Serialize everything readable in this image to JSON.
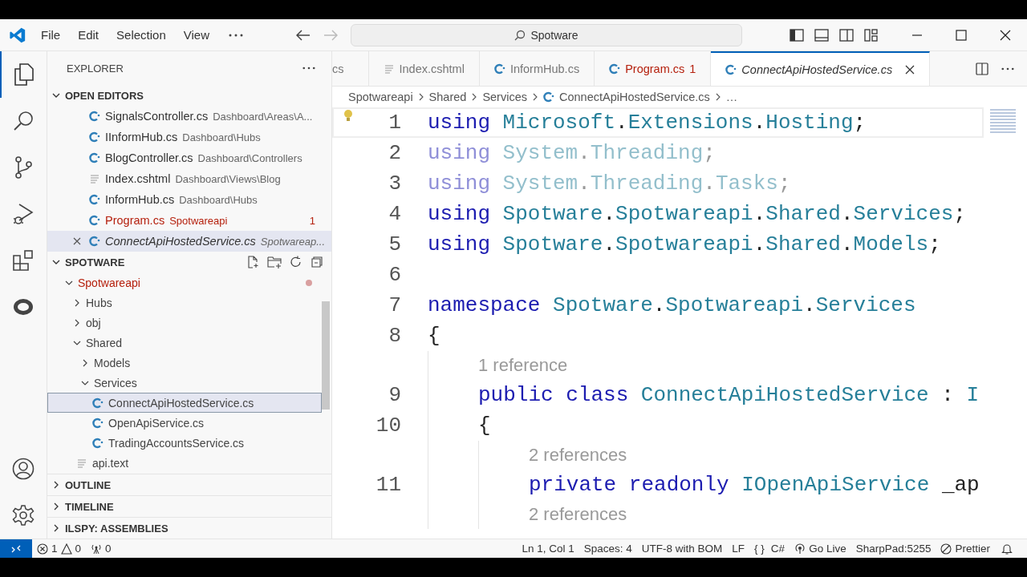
{
  "title_bar": {
    "menus": [
      "File",
      "Edit",
      "Selection",
      "View"
    ],
    "search": "Spotware"
  },
  "explorer": {
    "title": "EXPLORER",
    "open_editors": {
      "title": "OPEN EDITORS",
      "expanded": true,
      "items": [
        {
          "name": "SignalsController.cs",
          "path": "Dashboard\\Areas\\A...",
          "kind": "csharp",
          "error": false,
          "selected": false,
          "preview": false
        },
        {
          "name": "IInformHub.cs",
          "path": "Dashboard\\Hubs",
          "kind": "csharp",
          "error": false,
          "selected": false,
          "preview": false
        },
        {
          "name": "BlogController.cs",
          "path": "Dashboard\\Controllers",
          "kind": "csharp",
          "error": false,
          "selected": false,
          "preview": false
        },
        {
          "name": "Index.cshtml",
          "path": "Dashboard\\Views\\Blog",
          "kind": "text",
          "error": false,
          "selected": false,
          "preview": false
        },
        {
          "name": "InformHub.cs",
          "path": "Dashboard\\Hubs",
          "kind": "csharp",
          "error": false,
          "selected": false,
          "preview": false
        },
        {
          "name": "Program.cs",
          "path": "Spotwareapi",
          "kind": "csharp",
          "error": true,
          "badge": "1",
          "selected": false,
          "preview": false
        },
        {
          "name": "ConnectApiHostedService.cs",
          "path": "Spotwareap...",
          "kind": "csharp",
          "error": false,
          "selected": true,
          "preview": true
        }
      ]
    },
    "folder": {
      "title": "SPOTWARE",
      "expanded": true,
      "tree": [
        {
          "label": "Spotwareapi",
          "kind": "folder",
          "expanded": true,
          "modified": true,
          "selected": false,
          "children": [
            {
              "label": "Hubs",
              "kind": "folder",
              "expanded": false,
              "modified": false,
              "selected": false
            },
            {
              "label": "obj",
              "kind": "folder",
              "expanded": false,
              "modified": false,
              "selected": false
            },
            {
              "label": "Shared",
              "kind": "folder",
              "expanded": true,
              "modified": false,
              "selected": false,
              "children": [
                {
                  "label": "Models",
                  "kind": "folder",
                  "expanded": false,
                  "modified": false,
                  "selected": false
                },
                {
                  "label": "Services",
                  "kind": "folder",
                  "expanded": true,
                  "modified": false,
                  "selected": false,
                  "children": [
                    {
                      "label": "ConnectApiHostedService.cs",
                      "kind": "csharp",
                      "modified": false,
                      "selected": true
                    },
                    {
                      "label": "OpenApiService.cs",
                      "kind": "csharp",
                      "modified": false,
                      "selected": false
                    },
                    {
                      "label": "TradingAccountsService.cs",
                      "kind": "csharp",
                      "modified": false,
                      "selected": false
                    }
                  ]
                }
              ]
            },
            {
              "label": "api.text",
              "kind": "text",
              "modified": false,
              "selected": false
            }
          ]
        }
      ]
    },
    "sections": [
      {
        "title": "OUTLINE",
        "expanded": false
      },
      {
        "title": "TIMELINE",
        "expanded": false
      },
      {
        "title": "ILSPY: ASSEMBLIES",
        "expanded": false
      }
    ]
  },
  "tabs": [
    {
      "label": "cs",
      "kind": "none",
      "error": false,
      "selected": false,
      "preview": false
    },
    {
      "label": "Index.cshtml",
      "kind": "text",
      "error": false,
      "selected": false,
      "preview": false
    },
    {
      "label": "InformHub.cs",
      "kind": "csharp",
      "error": false,
      "selected": false,
      "preview": false
    },
    {
      "label": "Program.cs",
      "kind": "csharp",
      "error": true,
      "badge": "1",
      "selected": false,
      "preview": false
    },
    {
      "label": "ConnectApiHostedService.cs",
      "kind": "csharp",
      "error": false,
      "selected": true,
      "preview": true
    }
  ],
  "breadcrumb": [
    {
      "label": "Spotwareapi",
      "kind": "folder"
    },
    {
      "label": "Shared",
      "kind": "folder"
    },
    {
      "label": "Services",
      "kind": "folder"
    },
    {
      "label": "ConnectApiHostedService.cs",
      "kind": "csharp"
    },
    {
      "label": "…",
      "kind": "more"
    }
  ],
  "code": [
    {
      "kind": "code",
      "number": "1",
      "current": true,
      "faded": false,
      "tokens": [
        {
          "text": "using",
          "kind": "keyword"
        },
        {
          "text": "Microsoft",
          "kind": "type",
          "gap": true
        },
        {
          "text": ".",
          "kind": "plain"
        },
        {
          "text": "Extensions",
          "kind": "type"
        },
        {
          "text": ".",
          "kind": "plain"
        },
        {
          "text": "Hosting",
          "kind": "type"
        },
        {
          "text": ";",
          "kind": "plain"
        }
      ]
    },
    {
      "kind": "code",
      "number": "2",
      "current": false,
      "faded": true,
      "tokens": [
        {
          "text": "using",
          "kind": "keyword"
        },
        {
          "text": "System",
          "kind": "type",
          "gap": true
        },
        {
          "text": ".",
          "kind": "plain"
        },
        {
          "text": "Threading",
          "kind": "type"
        },
        {
          "text": ";",
          "kind": "plain"
        }
      ]
    },
    {
      "kind": "code",
      "number": "3",
      "current": false,
      "faded": true,
      "tokens": [
        {
          "text": "using",
          "kind": "keyword"
        },
        {
          "text": "System",
          "kind": "type",
          "gap": true
        },
        {
          "text": ".",
          "kind": "plain"
        },
        {
          "text": "Threading",
          "kind": "type"
        },
        {
          "text": ".",
          "kind": "plain"
        },
        {
          "text": "Tasks",
          "kind": "type"
        },
        {
          "text": ";",
          "kind": "plain"
        }
      ]
    },
    {
      "kind": "code",
      "number": "4",
      "current": false,
      "faded": false,
      "tokens": [
        {
          "text": "using",
          "kind": "keyword"
        },
        {
          "text": "Spotware",
          "kind": "type",
          "gap": true
        },
        {
          "text": ".",
          "kind": "plain"
        },
        {
          "text": "Spotwareapi",
          "kind": "type"
        },
        {
          "text": ".",
          "kind": "plain"
        },
        {
          "text": "Shared",
          "kind": "type"
        },
        {
          "text": ".",
          "kind": "plain"
        },
        {
          "text": "Services",
          "kind": "type"
        },
        {
          "text": ";",
          "kind": "plain"
        }
      ]
    },
    {
      "kind": "code",
      "number": "5",
      "current": false,
      "faded": false,
      "tokens": [
        {
          "text": "using",
          "kind": "keyword"
        },
        {
          "text": "Spotware",
          "kind": "type",
          "gap": true
        },
        {
          "text": ".",
          "kind": "plain"
        },
        {
          "text": "Spotwareapi",
          "kind": "type"
        },
        {
          "text": ".",
          "kind": "plain"
        },
        {
          "text": "Shared",
          "kind": "type"
        },
        {
          "text": ".",
          "kind": "plain"
        },
        {
          "text": "Models",
          "kind": "type"
        },
        {
          "text": ";",
          "kind": "plain"
        }
      ]
    },
    {
      "kind": "code",
      "number": "6",
      "current": false
    },
    {
      "kind": "code",
      "number": "7",
      "current": false,
      "faded": false,
      "tokens": [
        {
          "text": "namespace",
          "kind": "keyword"
        },
        {
          "text": "Spotware",
          "kind": "type",
          "gap": true
        },
        {
          "text": ".",
          "kind": "plain"
        },
        {
          "text": "Spotwareapi",
          "kind": "type"
        },
        {
          "text": ".",
          "kind": "plain"
        },
        {
          "text": "Services",
          "kind": "type"
        }
      ]
    },
    {
      "kind": "code",
      "number": "8",
      "current": false,
      "faded": false,
      "tokens": [
        {
          "text": "{",
          "kind": "plain"
        }
      ],
      "children": [
        {
          "kind": "lens",
          "text": "1 reference"
        },
        {
          "kind": "code",
          "number": "9",
          "current": false,
          "faded": false,
          "tokens": [
            {
              "text": "public class",
              "kind": "keyword"
            },
            {
              "text": "ConnectApiHostedService",
              "kind": "type",
              "gap": true
            },
            {
              "text": ":",
              "kind": "plain",
              "gap": true
            },
            {
              "text": "I",
              "kind": "type",
              "gap": true
            }
          ]
        },
        {
          "kind": "code",
          "number": "10",
          "current": false,
          "faded": false,
          "tokens": [
            {
              "text": "{",
              "kind": "plain"
            }
          ],
          "children": [
            {
              "kind": "lens",
              "text": "2 references"
            },
            {
              "kind": "code",
              "number": "11",
              "current": false,
              "faded": false,
              "tokens": [
                {
                  "text": "private readonly",
                  "kind": "keyword"
                },
                {
                  "text": "IOpenApiService",
                  "kind": "type",
                  "gap": true
                },
                {
                  "text": "_ap",
                  "kind": "plain",
                  "gap": true
                }
              ]
            },
            {
              "kind": "lens",
              "text": "2 references"
            }
          ]
        }
      ]
    }
  ],
  "status_bar": {
    "errors": "1",
    "warnings": "0",
    "ports": "0",
    "right": [
      {
        "text": "Ln 1, Col 1",
        "kind": "plain"
      },
      {
        "text": "Spaces: 4",
        "kind": "plain"
      },
      {
        "text": "UTF-8 with BOM",
        "kind": "plain"
      },
      {
        "text": "LF",
        "kind": "plain"
      },
      {
        "text": "C#",
        "kind": "braces",
        "glyph": "{ }"
      },
      {
        "text": "Go Live",
        "kind": "broadcast"
      },
      {
        "text": "SharpPad:5255",
        "kind": "plain"
      },
      {
        "text": "Prettier",
        "kind": "blocked"
      },
      {
        "kind": "bell"
      }
    ]
  }
}
